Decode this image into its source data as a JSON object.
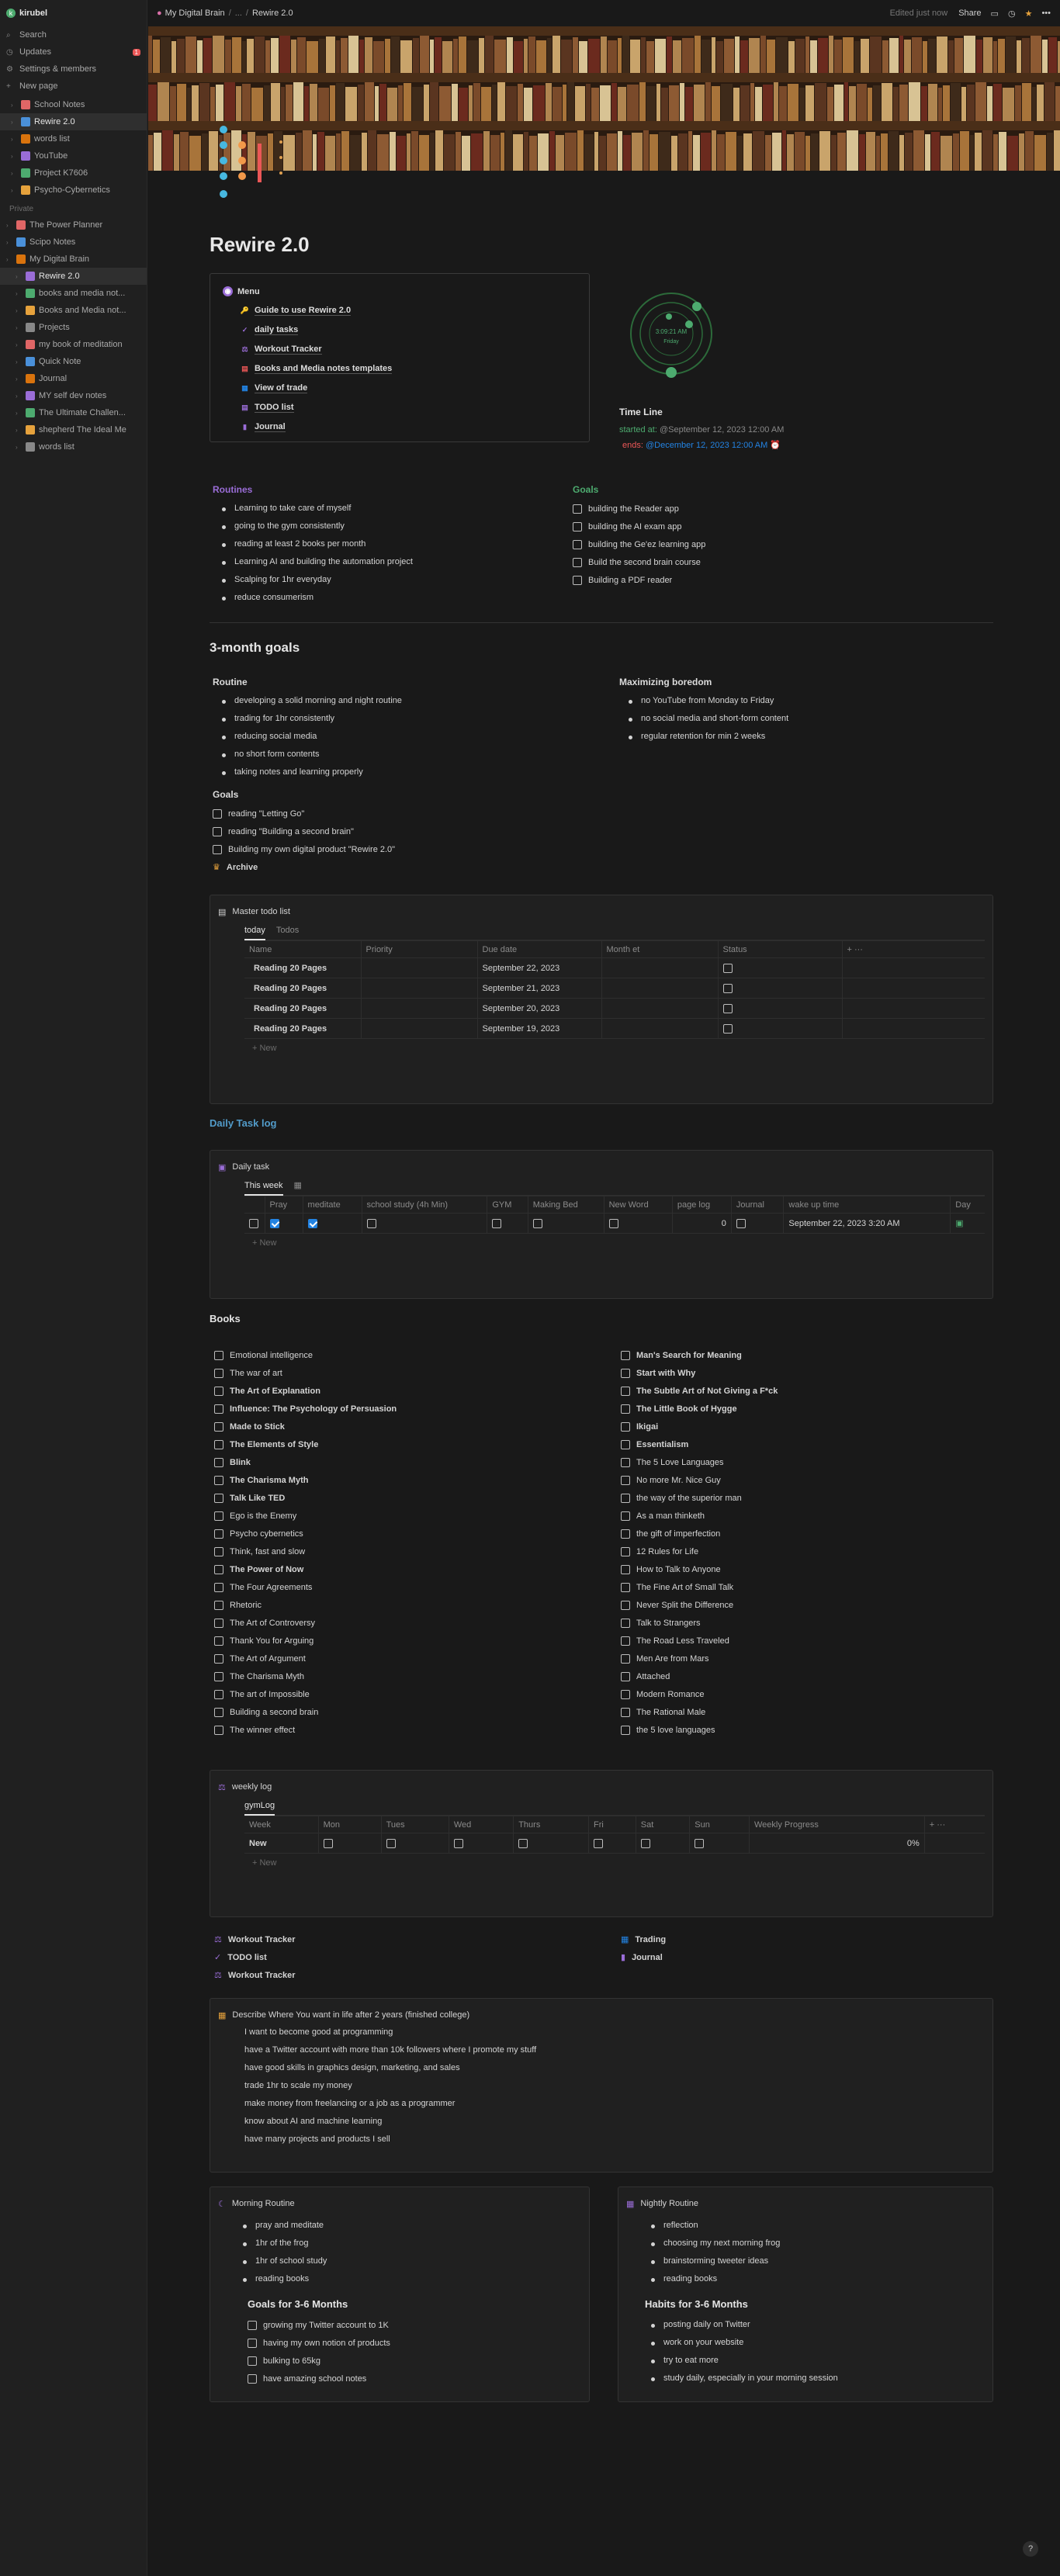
{
  "sidebar": {
    "workspace": "kirubel",
    "top": [
      {
        "label": "Search",
        "icon": "search-icon"
      },
      {
        "label": "Updates",
        "icon": "clock-icon",
        "badge": "1"
      },
      {
        "label": "Settings & members",
        "icon": "gear-icon"
      },
      {
        "label": "New page",
        "icon": "plus-icon"
      }
    ],
    "team": [
      {
        "label": "School Notes"
      },
      {
        "label": "Rewire 2.0"
      },
      {
        "label": "words list"
      },
      {
        "label": "YouTube"
      },
      {
        "label": "Project K7606"
      },
      {
        "label": "Psycho-Cybernetics"
      }
    ],
    "private_label": "Private",
    "private": [
      {
        "label": "The Power Planner"
      },
      {
        "label": "Scipo Notes"
      },
      {
        "label": "My Digital Brain"
      },
      {
        "label": "Rewire 2.0"
      },
      {
        "label": "books and media not..."
      },
      {
        "label": "Books and Media not..."
      },
      {
        "label": "Projects"
      },
      {
        "label": "my book of meditation"
      },
      {
        "label": "Quick Note"
      },
      {
        "label": "Journal"
      },
      {
        "label": "MY self dev notes"
      },
      {
        "label": "The Ultimate Challen..."
      },
      {
        "label": "shepherd The Ideal Me"
      },
      {
        "label": "words list"
      }
    ]
  },
  "topbar": {
    "crumb1": "My Digital Brain",
    "sep": "/",
    "crumb2": "...",
    "sep2": "/",
    "crumb3": "Rewire 2.0",
    "edited": "Edited just now",
    "share": "Share"
  },
  "page": {
    "title": "Rewire 2.0"
  },
  "menu": {
    "title": "Menu",
    "items": [
      "Guide to use Rewire 2.0",
      "daily tasks",
      "Workout Tracker",
      "Books and Media notes templates",
      "View of trade",
      "TODO list",
      "Journal"
    ]
  },
  "clock": {
    "time": "3:09:21 AM",
    "day": "Friday"
  },
  "timeline": {
    "title": "Time Line",
    "started_label": "started at:",
    "started": "@September 12, 2023 12:00 AM",
    "ends_label": "ends:",
    "ends": "@December 12, 2023 12:00 AM"
  },
  "routines": {
    "title": "Routines",
    "items": [
      "Learning to take care of myself",
      "going to the gym consistently",
      "reading at least 2 books per month",
      "Learning AI and building the automation project",
      "Scalping for 1hr everyday",
      "reduce consumerism"
    ]
  },
  "goals": {
    "title": "Goals",
    "items": [
      "building the Reader app",
      "building the AI exam app",
      "building the Ge'ez learning app",
      "Build the second brain course",
      "Building a PDF reader"
    ]
  },
  "three_month": {
    "title": "3-month goals",
    "routine_title": "Routine",
    "routine": [
      "developing a solid morning and night routine",
      "trading for 1hr consistently",
      "reducing social media",
      "no short form contents",
      "taking notes and learning properly"
    ],
    "boredom_title": "Maximizing boredom",
    "boredom": [
      "no YouTube from Monday to Friday",
      "no social media and short-form content",
      "regular retention  for min 2 weeks"
    ],
    "goals_title": "Goals",
    "goals": [
      "reading \"Letting Go\"",
      "reading \"Building a second brain\"",
      "Building my own digital product \"Rewire 2.0\""
    ],
    "archive": "Archive"
  },
  "master": {
    "title": "Master todo list",
    "tabs": [
      "today",
      "Todos"
    ],
    "cols": [
      "Name",
      "Priority",
      "Due date",
      "Month et",
      "Status"
    ],
    "rows": [
      {
        "name": "Reading 20 Pages",
        "due": "September 22, 2023"
      },
      {
        "name": "Reading 20 Pages",
        "due": "September 21, 2023"
      },
      {
        "name": "Reading 20 Pages",
        "due": "September 20, 2023"
      },
      {
        "name": "Reading 20 Pages",
        "due": "September 19, 2023"
      }
    ],
    "new": "+ New"
  },
  "daily": {
    "heading": "Daily Task log",
    "title": "Daily task",
    "tab": "This week",
    "cols": [
      "Pray",
      "meditate",
      "school study (4h Min)",
      "GYM",
      "Making Bed",
      "New Word",
      "page log",
      "Journal",
      "wake up time",
      "Day"
    ],
    "row": {
      "pray": true,
      "meditate": true,
      "page_log": "0",
      "wake": "September 22, 2023 3:20 AM"
    },
    "new": "+ New"
  },
  "books": {
    "title": "Books",
    "left": [
      "Emotional intelligence",
      "The war of art",
      "The Art of Explanation",
      "Influence: The Psychology of Persuasion",
      "Made to Stick",
      "The Elements of Style",
      "Blink",
      "The Charisma Myth",
      "Talk Like TED",
      "Ego is the Enemy",
      "Psycho cybernetics",
      "Think, fast and slow",
      "The Power of Now",
      "The Four Agreements",
      "Rhetoric",
      "The Art of Controversy",
      "Thank You for Arguing",
      "The Art of Argument",
      "The Charisma Myth",
      "The art of Impossible",
      "Building a second brain",
      "The winner effect"
    ],
    "right": [
      "Man's Search for Meaning",
      "Start with Why",
      "The Subtle Art of Not Giving a F*ck",
      "The Little Book of Hygge",
      "Ikigai",
      "Essentialism",
      "The 5 Love Languages",
      "No more Mr. Nice Guy",
      "the way of the superior man",
      "As a man thinketh",
      "the gift of imperfection",
      "12 Rules for Life",
      "How to Talk to Anyone",
      "The Fine Art of Small Talk",
      "Never Split the Difference",
      "Talk to Strangers",
      "The Road Less Traveled",
      "Men Are from Mars",
      "Attached",
      "Modern Romance",
      "The Rational Male",
      "the 5 love languages"
    ]
  },
  "weekly": {
    "title": "weekly log",
    "tab": "gymLog",
    "cols": [
      "Week",
      "Mon",
      "Tues",
      "Wed",
      "Thurs",
      "Fri",
      "Sat",
      "Sun",
      "Weekly Progress"
    ],
    "row_name": "New",
    "progress": "0%",
    "new": "+ New"
  },
  "links_left": [
    "Workout Tracker",
    "TODO list",
    "Workout Tracker"
  ],
  "links_right": [
    "Trading",
    "Journal"
  ],
  "describe": {
    "title": "Describe Where You want in life after 2 years (finished college)",
    "items": [
      "I want to become good at programming",
      "have a Twitter account with more than 10k followers where I promote my stuff",
      "have good skills in graphics design, marketing, and sales",
      "trade 1hr to scale my money",
      "make money from freelancing or a job as a programmer",
      "know about AI and machine learning",
      "have many projects and products I sell"
    ]
  },
  "morning": {
    "title": "Morning Routine",
    "items": [
      "pray and meditate",
      "1hr of the frog",
      "1hr of school study",
      "reading books"
    ],
    "goals_title": "Goals for 3-6 Months",
    "goals": [
      "growing my Twitter account to 1K",
      "having my own notion of products",
      "bulking to 65kg",
      "have amazing school notes"
    ]
  },
  "nightly": {
    "title": "Nightly Routine",
    "items": [
      "reflection",
      "choosing my next morning frog",
      "brainstorming tweeter ideas",
      "reading books"
    ],
    "habits_title": "Habits for 3-6 Months",
    "habits": [
      "posting daily on Twitter",
      "work on your website",
      "try to eat more",
      "study daily, especially in your morning session"
    ]
  },
  "help": "?",
  "colors": {
    "accent": "#2383e2",
    "purple": "#9a6dd7",
    "green": "#4dab6f",
    "orange": "#d9730d",
    "red": "#eb5757"
  }
}
